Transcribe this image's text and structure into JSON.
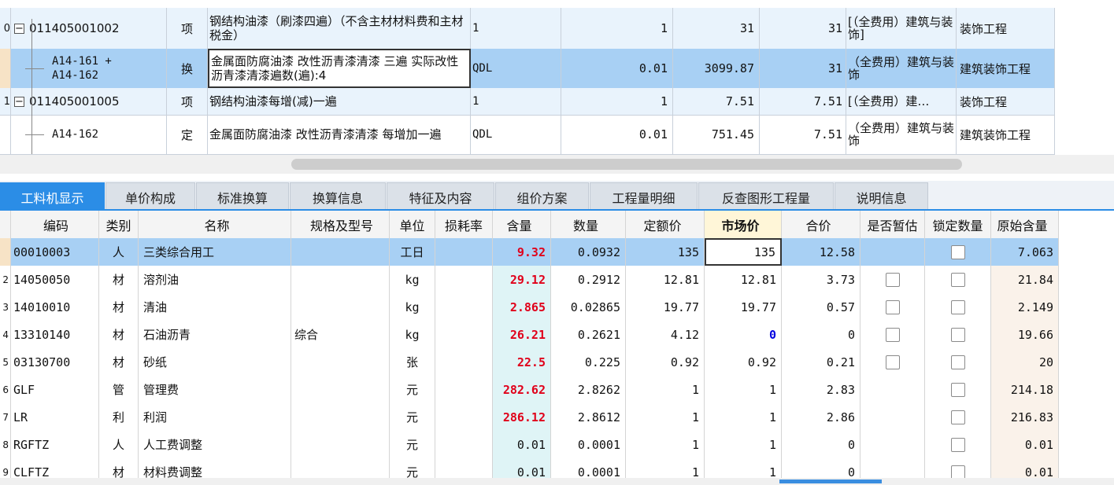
{
  "upper": {
    "rows": [
      {
        "idx": "0",
        "code": "011405001002",
        "expander": "−",
        "type": "项",
        "name": "钢结构油漆（刷漆四遍）（不含主材材料费和主材税金）",
        "unit": "1",
        "qty": "1",
        "price": "31",
        "total": "31",
        "fee": "[（全费用）建筑与装饰]",
        "prof": "装饰工程"
      },
      {
        "idx": "",
        "code": "A14-161 + A14-162",
        "type": "换",
        "name": "金属面防腐油漆 改性沥青漆清漆 三遍 实际改性沥青漆清漆遍数(遍):4",
        "unit": "QDL",
        "qty": "0.01",
        "price": "3099.87",
        "total": "31",
        "fee": "（全费用）建筑与装饰",
        "prof": "建筑装饰工程"
      },
      {
        "idx": "1",
        "code": "011405001005",
        "expander": "−",
        "type": "项",
        "name": "钢结构油漆每增(减)一遍",
        "unit": "1",
        "qty": "1",
        "price": "7.51",
        "total": "7.51",
        "fee": "[（全费用）建…",
        "prof": "装饰工程"
      },
      {
        "idx": "",
        "code": "A14-162",
        "type": "定",
        "name": "金属面防腐油漆 改性沥青漆清漆 每增加一遍",
        "unit": "QDL",
        "qty": "0.01",
        "price": "751.45",
        "total": "7.51",
        "fee": "（全费用）建筑与装饰",
        "prof": "建筑装饰工程"
      }
    ]
  },
  "tabs": [
    {
      "label": "工料机显示"
    },
    {
      "label": "单价构成"
    },
    {
      "label": "标准换算"
    },
    {
      "label": "换算信息"
    },
    {
      "label": "特征及内容"
    },
    {
      "label": "组价方案"
    },
    {
      "label": "工程量明细"
    },
    {
      "label": "反查图形工程量"
    },
    {
      "label": "说明信息"
    }
  ],
  "lower": {
    "headers": {
      "code": "编码",
      "type": "类别",
      "name": "名称",
      "spec": "规格及型号",
      "unit": "单位",
      "loss": "损耗率",
      "content": "含量",
      "qty": "数量",
      "quota": "定额价",
      "market": "市场价",
      "sum": "合价",
      "estimate": "是否暂估",
      "lock": "锁定数量",
      "orig": "原始含量"
    },
    "rows": [
      {
        "idx": "",
        "code": "00010003",
        "type": "人",
        "name": "三类综合用工",
        "spec": "",
        "unit": "工日",
        "content": "9.32",
        "qty": "0.0932",
        "quota": "135",
        "market": "135",
        "sum": "12.58",
        "orig": "7.063"
      },
      {
        "idx": "2",
        "code": "14050050",
        "type": "材",
        "name": "溶剂油",
        "spec": "",
        "unit": "kg",
        "content": "29.12",
        "qty": "0.2912",
        "quota": "12.81",
        "market": "12.81",
        "sum": "3.73",
        "orig": "21.84"
      },
      {
        "idx": "3",
        "code": "14010010",
        "type": "材",
        "name": "清油",
        "spec": "",
        "unit": "kg",
        "content": "2.865",
        "qty": "0.02865",
        "quota": "19.77",
        "market": "19.77",
        "sum": "0.57",
        "orig": "2.149"
      },
      {
        "idx": "4",
        "code": "13310140",
        "type": "材",
        "name": "石油沥青",
        "spec": "综合",
        "unit": "kg",
        "content": "26.21",
        "qty": "0.2621",
        "quota": "4.12",
        "market": "0",
        "sum": "0",
        "orig": "19.66"
      },
      {
        "idx": "5",
        "code": "03130700",
        "type": "材",
        "name": "砂纸",
        "spec": "",
        "unit": "张",
        "content": "22.5",
        "qty": "0.225",
        "quota": "0.92",
        "market": "0.92",
        "sum": "0.21",
        "orig": "20"
      },
      {
        "idx": "6",
        "code": "GLF",
        "type": "管",
        "name": "管理费",
        "spec": "",
        "unit": "元",
        "content": "282.62",
        "qty": "2.8262",
        "quota": "1",
        "market": "1",
        "sum": "2.83",
        "orig": "214.18"
      },
      {
        "idx": "7",
        "code": "LR",
        "type": "利",
        "name": "利润",
        "spec": "",
        "unit": "元",
        "content": "286.12",
        "qty": "2.8612",
        "quota": "1",
        "market": "1",
        "sum": "2.86",
        "orig": "216.83"
      },
      {
        "idx": "8",
        "code": "RGFTZ",
        "type": "人",
        "name": "人工费调整",
        "spec": "",
        "unit": "元",
        "content": "0.01",
        "qty": "0.0001",
        "quota": "1",
        "market": "1",
        "sum": "0",
        "orig": "0.01"
      },
      {
        "idx": "9",
        "code": "CLFTZ",
        "type": "材",
        "name": "材料费调整",
        "spec": "",
        "unit": "元",
        "content": "0.01",
        "qty": "0.0001",
        "quota": "1",
        "market": "1",
        "sum": "0",
        "orig": "0.01"
      }
    ]
  },
  "colors": {
    "accent": "#2b8de6",
    "selected_row": "#a8d0f4",
    "content_red": "#e0001a",
    "zero_blue": "#0000e0"
  }
}
